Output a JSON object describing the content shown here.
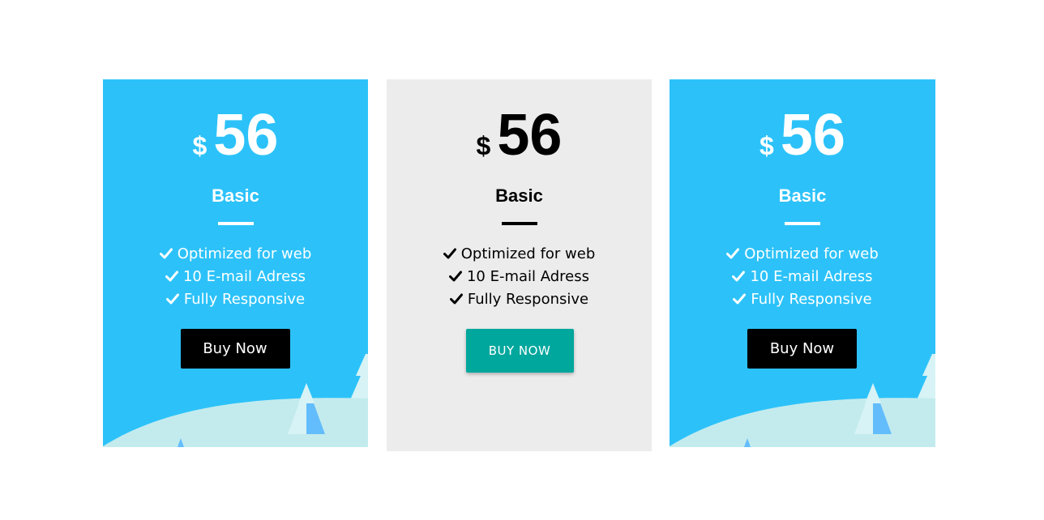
{
  "colors": {
    "blue_card": "#2cc2f9",
    "grey_card": "#ececec",
    "dark_button": "#000000",
    "teal_button": "#00a79d",
    "snow": "#c3ebee",
    "tree_light": "#d7f3f5",
    "tree_blue": "#63bdfc"
  },
  "cards": [
    {
      "currency": "$",
      "amount": "56",
      "plan": "Basic",
      "features": [
        "Optimized for web",
        "10 E-mail Adress",
        "Fully Responsive"
      ],
      "button_label": "Buy Now",
      "feature_icon": "check-icon"
    },
    {
      "currency": "$",
      "amount": "56",
      "plan": "Basic",
      "features": [
        "Optimized for web",
        "10 E-mail Adress",
        "Fully Responsive"
      ],
      "button_label": "BUY NOW",
      "feature_icon": "check-icon"
    },
    {
      "currency": "$",
      "amount": "56",
      "plan": "Basic",
      "features": [
        "Optimized for web",
        "10 E-mail Adress",
        "Fully Responsive"
      ],
      "button_label": "Buy Now",
      "feature_icon": "check-icon"
    }
  ]
}
